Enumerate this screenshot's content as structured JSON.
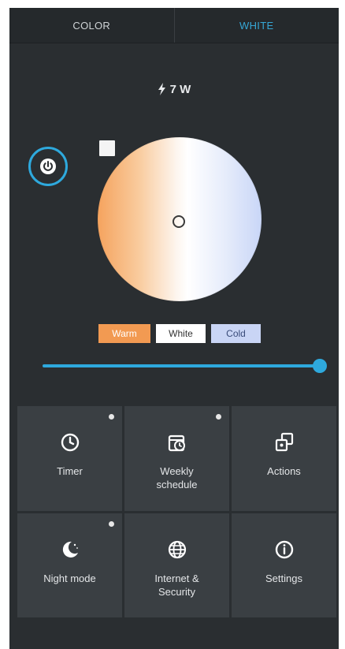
{
  "tabs": [
    {
      "label": "COLOR",
      "active": false
    },
    {
      "label": "WHITE",
      "active": true
    }
  ],
  "power": {
    "value": "7 W",
    "icon": "bolt-icon"
  },
  "presets": {
    "warm": "Warm",
    "white": "White",
    "cold": "Cold"
  },
  "slider": {
    "value_percent": 100
  },
  "tiles": [
    {
      "label": "Timer",
      "icon": "clock-icon",
      "badge": true
    },
    {
      "label": "Weekly\nschedule",
      "icon": "weekly-schedule-icon",
      "badge": true
    },
    {
      "label": "Actions",
      "icon": "actions-icon",
      "badge": false
    },
    {
      "label": "Night mode",
      "icon": "moon-icon",
      "badge": true
    },
    {
      "label": "Internet &\nSecurity",
      "icon": "globe-icon",
      "badge": false
    },
    {
      "label": "Settings",
      "icon": "info-icon",
      "badge": false
    }
  ],
  "colors": {
    "accent": "#2ea9dd",
    "warm": "#f29a52",
    "cold": "#c9d5f5",
    "background": "#2a2e31",
    "tile": "#3a3f43"
  }
}
